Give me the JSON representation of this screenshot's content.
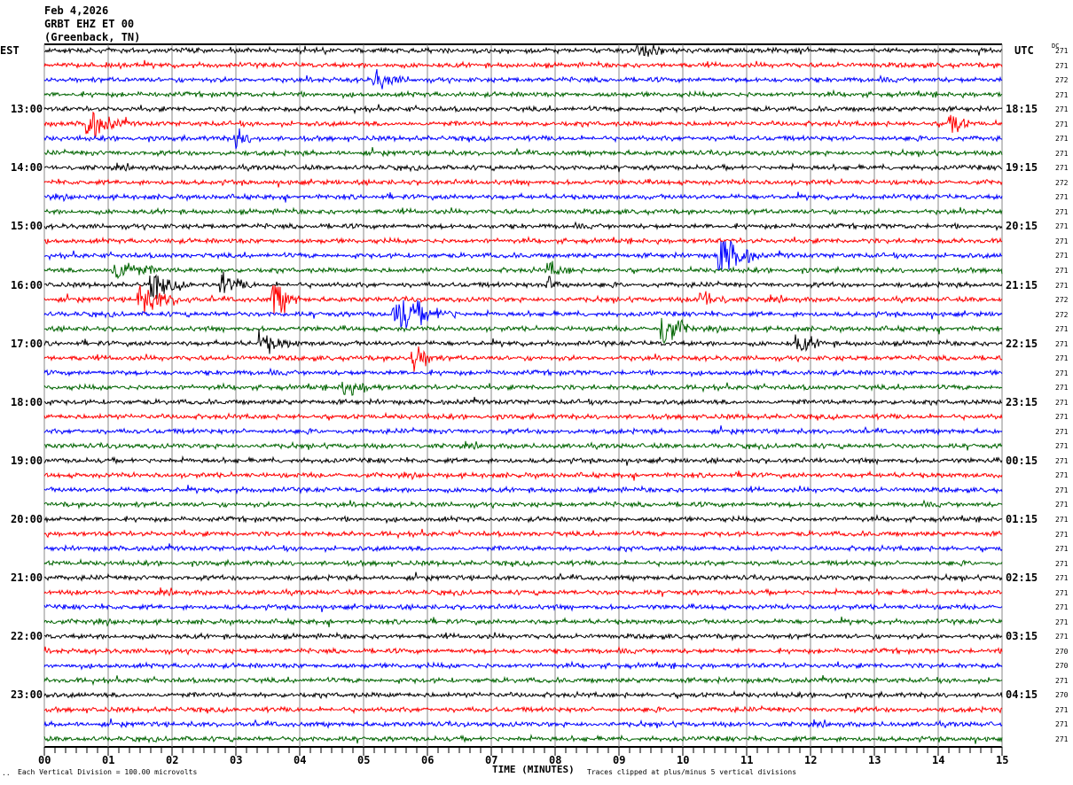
{
  "header": {
    "date": "Feb 4,2026",
    "station": "GRBT EHZ ET 00",
    "location": "(Greenback, TN)"
  },
  "left_axis_title": "EST",
  "right_axis_title": "UTC",
  "dc_title": "DC",
  "footer": {
    "scale_mark": "..",
    "scale_note": "Each Vertical Division =  100.00 microvolts",
    "xlabel": "TIME (MINUTES)",
    "clip_note": "Traces clipped at plus/minus 5 vertical divisions"
  },
  "chart_data": {
    "type": "line",
    "title": "GRBT EHZ ET 00 helicorder",
    "xlabel": "TIME (MINUTES)",
    "xlim": [
      0,
      15
    ],
    "x_ticks": [
      "00",
      "01",
      "02",
      "03",
      "04",
      "05",
      "06",
      "07",
      "08",
      "09",
      "10",
      "11",
      "12",
      "13",
      "14",
      "15"
    ],
    "est_labels": [
      "13:00",
      "14:00",
      "15:00",
      "16:00",
      "17:00",
      "18:00",
      "19:00",
      "20:00",
      "21:00",
      "22:00",
      "23:00"
    ],
    "utc_labels": [
      "18:15",
      "19:15",
      "20:15",
      "21:15",
      "22:15",
      "23:15",
      "00:15",
      "01:15",
      "02:15",
      "03:15",
      "04:15"
    ],
    "trace_colors": [
      "#000000",
      "#ff0000",
      "#0000ff",
      "#006400"
    ],
    "rows": 48,
    "dc_values": [
      "271",
      "271",
      "272",
      "271",
      "271",
      "271",
      "271",
      "271",
      "271",
      "272",
      "271",
      "271",
      "271",
      "271",
      "271",
      "271",
      "271",
      "272",
      "272",
      "271",
      "271",
      "271",
      "271",
      "271",
      "271",
      "271",
      "271",
      "271",
      "271",
      "271",
      "271",
      "271",
      "271",
      "271",
      "271",
      "271",
      "271",
      "271",
      "271",
      "271",
      "271",
      "270",
      "270",
      "271",
      "270",
      "271",
      "271",
      "271"
    ],
    "events": [
      {
        "row": 0,
        "minute": 9.3,
        "amp": 2.5,
        "dur": 0.4
      },
      {
        "row": 2,
        "minute": 5.2,
        "amp": 2.5,
        "dur": 0.5
      },
      {
        "row": 5,
        "minute": 0.7,
        "amp": 4,
        "dur": 0.6
      },
      {
        "row": 5,
        "minute": 14.2,
        "amp": 4,
        "dur": 0.3
      },
      {
        "row": 6,
        "minute": 3.0,
        "amp": 2.5,
        "dur": 0.4
      },
      {
        "row": 14,
        "minute": 10.6,
        "amp": 7,
        "dur": 0.6
      },
      {
        "row": 15,
        "minute": 1.1,
        "amp": 3.5,
        "dur": 0.7
      },
      {
        "row": 15,
        "minute": 7.9,
        "amp": 2,
        "dur": 0.4
      },
      {
        "row": 16,
        "minute": 1.7,
        "amp": 3,
        "dur": 0.6
      },
      {
        "row": 16,
        "minute": 2.8,
        "amp": 2.5,
        "dur": 0.5
      },
      {
        "row": 16,
        "minute": 7.9,
        "amp": 2.5,
        "dur": 0.4
      },
      {
        "row": 17,
        "minute": 1.5,
        "amp": 4,
        "dur": 0.8
      },
      {
        "row": 17,
        "minute": 3.6,
        "amp": 6,
        "dur": 0.4
      },
      {
        "row": 17,
        "minute": 10.3,
        "amp": 2.5,
        "dur": 0.5
      },
      {
        "row": 18,
        "minute": 5.5,
        "amp": 5,
        "dur": 1.0
      },
      {
        "row": 19,
        "minute": 9.7,
        "amp": 5,
        "dur": 0.5
      },
      {
        "row": 20,
        "minute": 3.4,
        "amp": 2.5,
        "dur": 0.6
      },
      {
        "row": 20,
        "minute": 11.8,
        "amp": 2,
        "dur": 0.6
      },
      {
        "row": 21,
        "minute": 5.8,
        "amp": 4,
        "dur": 0.4
      },
      {
        "row": 23,
        "minute": 4.7,
        "amp": 2.5,
        "dur": 0.6
      }
    ]
  }
}
